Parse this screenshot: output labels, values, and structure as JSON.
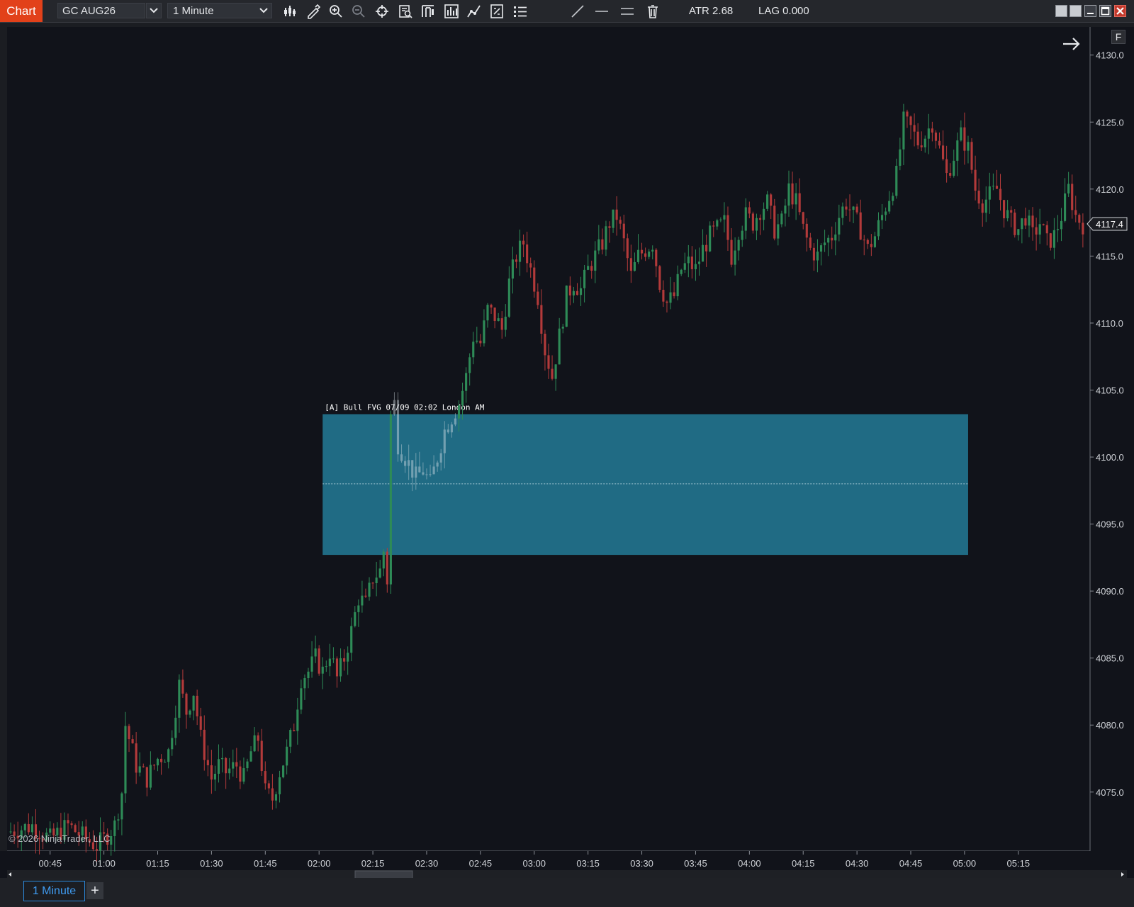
{
  "toolbar": {
    "app_label": "Chart",
    "instrument": "GC AUG26",
    "period": "1 Minute",
    "atr": "ATR 2.68",
    "lag": "LAG 0.000",
    "icons": [
      "bar-type-icon",
      "draw-pencil-icon",
      "zoom-in-icon",
      "zoom-out-icon",
      "crosshair-icon",
      "data-box-icon",
      "properties-icon",
      "strategies-icon",
      "indicators-icon",
      "templates-icon",
      "list-icon",
      "line-tool-icon",
      "horizontal-line-icon",
      "two-lines-icon",
      "trash-icon"
    ],
    "window_buttons": [
      "restore",
      "tile",
      "minimize",
      "maximize",
      "close"
    ]
  },
  "chart": {
    "right_panel_button": "F",
    "copyright": "© 2026 NinjaTrader, LLC",
    "last_price": "4117.4",
    "background_color": "#11131a",
    "bull_color": "#2e8b57",
    "bear_color": "#b33a3a",
    "fvg_color": "#22708a",
    "fvg_label": "[A]  Bull FVG  07/09  02:02  London AM"
  },
  "chart_data": {
    "type": "candlestick",
    "y_ticks": [
      4130.0,
      4125.0,
      4120.0,
      4115.0,
      4110.0,
      4105.0,
      4100.0,
      4095.0,
      4090.0,
      4085.0,
      4080.0,
      4075.0
    ],
    "x_ticks": [
      "00:45",
      "01:00",
      "01:15",
      "01:30",
      "01:45",
      "02:00",
      "02:15",
      "02:30",
      "02:45",
      "03:00",
      "03:15",
      "03:30",
      "03:45",
      "04:00",
      "04:15",
      "04:30",
      "04:45",
      "05:00",
      "05:15"
    ],
    "ylim": [
      4070.6,
      4132.1
    ],
    "xlim_minutes_from_0045": [
      -12,
      290
    ],
    "fvg_zone": {
      "top": 4103.2,
      "bottom": 4092.7,
      "mid": 4098.0,
      "start": "02:01",
      "end": "05:01"
    },
    "price_path": [
      [
        -12,
        4072
      ],
      [
        -5,
        4072.5
      ],
      [
        0,
        4071.5
      ],
      [
        5,
        4072.5
      ],
      [
        10,
        4071.5
      ],
      [
        13,
        4071
      ],
      [
        15,
        4071.5
      ],
      [
        18,
        4072.5
      ],
      [
        20,
        4075
      ],
      [
        21,
        4080
      ],
      [
        24,
        4077
      ],
      [
        27,
        4076
      ],
      [
        30,
        4077.5
      ],
      [
        33,
        4078
      ],
      [
        36,
        4083
      ],
      [
        38,
        4081
      ],
      [
        40,
        4082.5
      ],
      [
        42,
        4079
      ],
      [
        45,
        4076
      ],
      [
        47,
        4077
      ],
      [
        49,
        4076.5
      ],
      [
        52,
        4077
      ],
      [
        54,
        4076
      ],
      [
        56,
        4078
      ],
      [
        58,
        4079
      ],
      [
        60,
        4075
      ],
      [
        62,
        4074.5
      ],
      [
        64,
        4076.5
      ],
      [
        66,
        4078
      ],
      [
        68,
        4080
      ],
      [
        70,
        4083.5
      ],
      [
        72,
        4084
      ],
      [
        74,
        4085
      ],
      [
        76,
        4084
      ],
      [
        78,
        4085.5
      ],
      [
        80,
        4083.5
      ],
      [
        82,
        4085
      ],
      [
        84,
        4087
      ],
      [
        86,
        4089.5
      ],
      [
        88,
        4089
      ],
      [
        90,
        4091
      ],
      [
        92,
        4091.5
      ],
      [
        93,
        4093
      ],
      [
        94,
        4091
      ],
      [
        95,
        4109
      ],
      [
        96,
        4104
      ],
      [
        97,
        4101
      ],
      [
        99,
        4100
      ],
      [
        102,
        4098.5
      ],
      [
        104,
        4099
      ],
      [
        106,
        4098
      ],
      [
        108,
        4100
      ],
      [
        110,
        4102
      ],
      [
        112,
        4103
      ],
      [
        114,
        4104
      ],
      [
        116,
        4106
      ],
      [
        118,
        4109
      ],
      [
        120,
        4108.5
      ],
      [
        122,
        4111
      ],
      [
        124,
        4110.5
      ],
      [
        126,
        4109.5
      ],
      [
        128,
        4113
      ],
      [
        130,
        4115
      ],
      [
        132,
        4116
      ],
      [
        134,
        4114
      ],
      [
        136,
        4112
      ],
      [
        138,
        4108
      ],
      [
        140,
        4106
      ],
      [
        142,
        4109
      ],
      [
        144,
        4112
      ],
      [
        146,
        4113
      ],
      [
        148,
        4112.5
      ],
      [
        150,
        4114
      ],
      [
        152,
        4115
      ],
      [
        154,
        4116
      ],
      [
        156,
        4117.5
      ],
      [
        158,
        4118
      ],
      [
        160,
        4116
      ],
      [
        162,
        4113.5
      ],
      [
        164,
        4115
      ],
      [
        166,
        4115.5
      ],
      [
        168,
        4116
      ],
      [
        170,
        4113
      ],
      [
        172,
        4111.5
      ],
      [
        174,
        4112
      ],
      [
        176,
        4114
      ],
      [
        178,
        4114.5
      ],
      [
        180,
        4114
      ],
      [
        182,
        4115.5
      ],
      [
        184,
        4116.5
      ],
      [
        186,
        4117
      ],
      [
        188,
        4117.5
      ],
      [
        190,
        4115
      ],
      [
        192,
        4117
      ],
      [
        194,
        4118
      ],
      [
        196,
        4117.5
      ],
      [
        198,
        4118.5
      ],
      [
        200,
        4119
      ],
      [
        202,
        4117
      ],
      [
        204,
        4117.5
      ],
      [
        206,
        4120
      ],
      [
        208,
        4119
      ],
      [
        210,
        4117
      ],
      [
        212,
        4115.5
      ],
      [
        214,
        4115
      ],
      [
        216,
        4116
      ],
      [
        218,
        4116.5
      ],
      [
        220,
        4118
      ],
      [
        222,
        4119
      ],
      [
        224,
        4118
      ],
      [
        226,
        4117
      ],
      [
        228,
        4115.5
      ],
      [
        230,
        4116.5
      ],
      [
        232,
        4118
      ],
      [
        234,
        4119.5
      ],
      [
        236,
        4121
      ],
      [
        238,
        4125
      ],
      [
        240,
        4124.5
      ],
      [
        242,
        4123.5
      ],
      [
        244,
        4124
      ],
      [
        246,
        4125
      ],
      [
        248,
        4123
      ],
      [
        250,
        4121
      ],
      [
        252,
        4122.5
      ],
      [
        254,
        4124
      ],
      [
        256,
        4123
      ],
      [
        258,
        4120
      ],
      [
        260,
        4119
      ],
      [
        262,
        4119.5
      ],
      [
        264,
        4120
      ],
      [
        266,
        4118.5
      ],
      [
        268,
        4117.5
      ],
      [
        270,
        4117
      ],
      [
        272,
        4118
      ],
      [
        274,
        4116.5
      ],
      [
        276,
        4117.5
      ],
      [
        278,
        4116
      ],
      [
        280,
        4116.5
      ],
      [
        282,
        4118
      ],
      [
        284,
        4120
      ],
      [
        286,
        4118
      ],
      [
        288,
        4117.4
      ]
    ]
  }
}
